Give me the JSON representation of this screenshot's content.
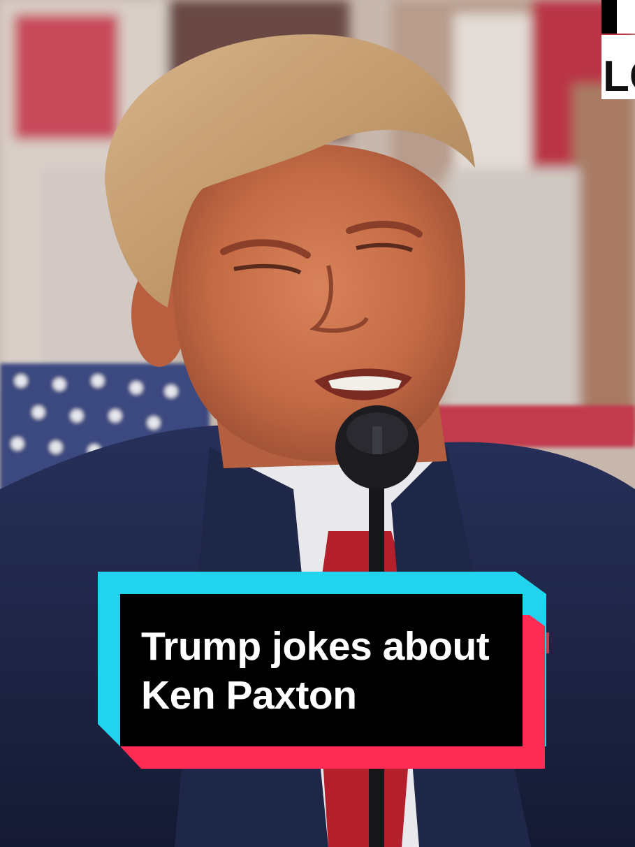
{
  "caption": {
    "lines": [
      "Trump jokes about",
      "Ken Paxton"
    ]
  },
  "logo": {
    "text": "LC"
  },
  "colors": {
    "caption_background": "#000000",
    "caption_text": "#ffffff",
    "accent_cyan": "#22d3ee",
    "accent_red": "#fe2c55",
    "suit": "#1c2447",
    "tie": "#b3202c"
  }
}
